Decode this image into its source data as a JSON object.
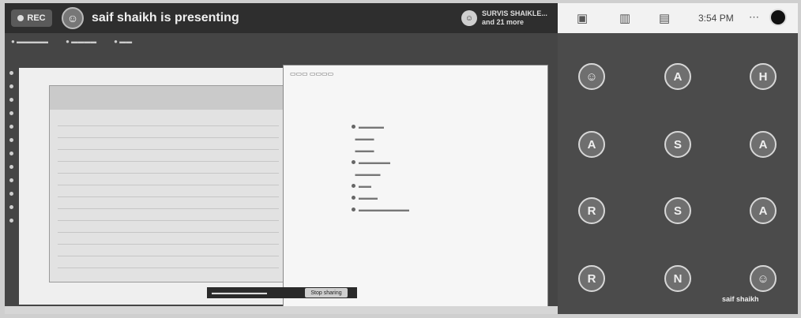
{
  "topbar": {
    "rec_label": "REC",
    "presenting_text": "saif shaikh is presenting",
    "participants_line1": "SURVIS SHAIKLE...",
    "participants_line2": "and 21 more"
  },
  "tray": {
    "time": "3:54 PM"
  },
  "grid": {
    "tiles": [
      {
        "letter": "A"
      },
      {
        "letter": "H"
      },
      {
        "letter": "A"
      },
      {
        "letter": "S"
      },
      {
        "letter": "A"
      },
      {
        "letter": "R"
      },
      {
        "letter": "S"
      },
      {
        "letter": "A"
      },
      {
        "letter": "R"
      },
      {
        "letter": "N"
      }
    ],
    "presenter_tile_name": "saif shaikh"
  },
  "share": {
    "stop_label": "Stop sharing"
  },
  "colors": {
    "frame_bg": "#3a3a3a",
    "tray_bg": "#f2f2f2",
    "tile_border": "#d7d7d7"
  }
}
